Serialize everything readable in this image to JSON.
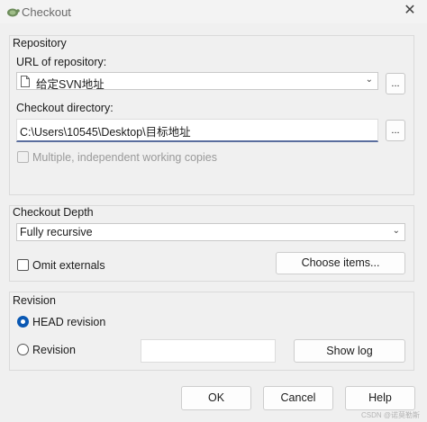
{
  "window": {
    "title": "Checkout",
    "close": "✕"
  },
  "repository": {
    "group_label": "Repository",
    "url_label": "URL of repository:",
    "url_value": "给定SVN地址",
    "url_browse": "...",
    "dir_label": "Checkout directory:",
    "dir_value": "C:\\Users\\10545\\Desktop\\目标地址",
    "dir_browse": "...",
    "multiple_label": "Multiple, independent working copies"
  },
  "depth": {
    "group_label": "Checkout Depth",
    "selected": "Fully recursive",
    "omit_externals": "Omit externals",
    "choose_items": "Choose items..."
  },
  "revision": {
    "group_label": "Revision",
    "head_label": "HEAD revision",
    "revision_label": "Revision",
    "revision_value": "",
    "show_log": "Show log"
  },
  "footer": {
    "ok": "OK",
    "cancel": "Cancel",
    "help": "Help"
  },
  "watermark": "CSDN @诺莫勒斯",
  "colors": {
    "accent": "#0a58b3"
  }
}
